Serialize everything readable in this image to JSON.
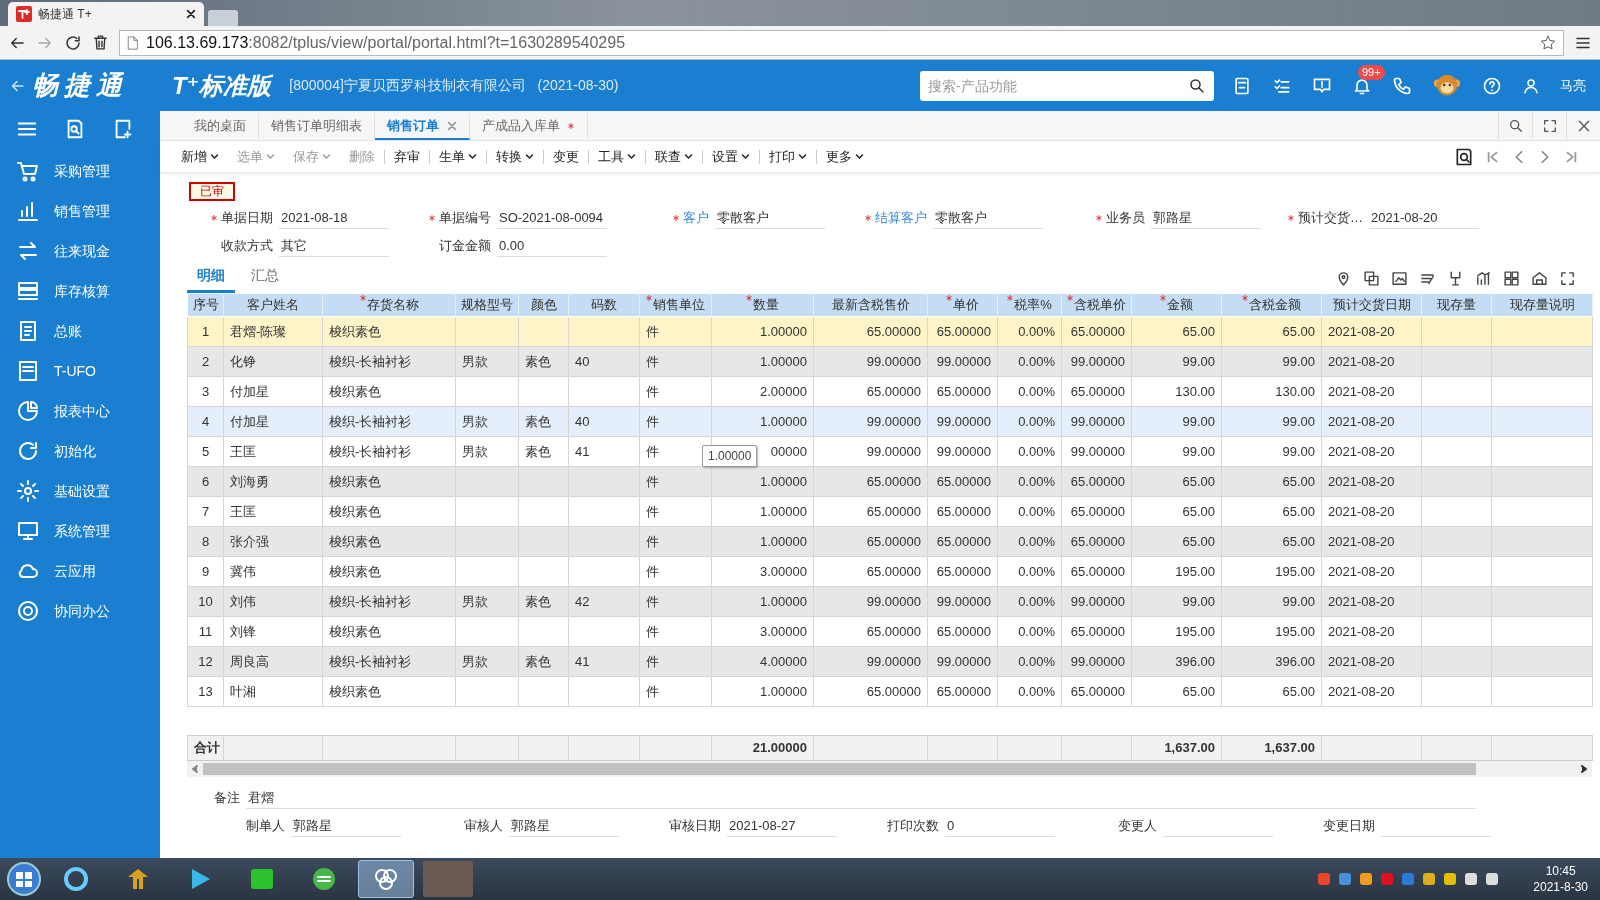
{
  "browser": {
    "tab_title": "畅捷通 T+",
    "url_host": "106.13.69.173",
    "url_path": ":8082/tplus/view/portal/portal.html?t=1630289540295"
  },
  "header": {
    "brand": "畅捷通",
    "edition": "T⁺标准版",
    "company": "[800004]宁夏贝西罗科技制衣有限公司   (2021-08-30)",
    "search_placeholder": "搜索-产品功能",
    "notification_badge": "99+",
    "user": "马亮"
  },
  "sidebar": {
    "items": [
      {
        "label": "采购管理"
      },
      {
        "label": "销售管理"
      },
      {
        "label": "往来现金"
      },
      {
        "label": "库存核算"
      },
      {
        "label": "总账"
      },
      {
        "label": "T-UFO"
      },
      {
        "label": "报表中心"
      },
      {
        "label": "初始化"
      },
      {
        "label": "基础设置"
      },
      {
        "label": "系统管理"
      },
      {
        "label": "云应用"
      },
      {
        "label": "协同办公"
      }
    ]
  },
  "doc_tabs": [
    {
      "label": "我的桌面",
      "selected": false,
      "closable": false,
      "modified": false
    },
    {
      "label": "销售订单明细表",
      "selected": false,
      "closable": false,
      "modified": false
    },
    {
      "label": "销售订单",
      "selected": true,
      "closable": true,
      "modified": false
    },
    {
      "label": "产成品入库单",
      "selected": false,
      "closable": false,
      "modified": true
    }
  ],
  "toolbar": [
    {
      "label": "新增",
      "dropdown": true,
      "disabled": false
    },
    {
      "label": "选单",
      "dropdown": true,
      "disabled": true
    },
    {
      "label": "保存",
      "dropdown": true,
      "disabled": true
    },
    {
      "label": "删除",
      "dropdown": false,
      "disabled": true
    },
    {
      "label": "弃审",
      "dropdown": false,
      "disabled": false
    },
    {
      "label": "生单",
      "dropdown": true,
      "disabled": false
    },
    {
      "label": "转换",
      "dropdown": true,
      "disabled": false
    },
    {
      "label": "变更",
      "dropdown": false,
      "disabled": false
    },
    {
      "label": "工具",
      "dropdown": true,
      "disabled": false
    },
    {
      "label": "联查",
      "dropdown": true,
      "disabled": false
    },
    {
      "label": "设置",
      "dropdown": true,
      "disabled": false
    },
    {
      "label": "打印",
      "dropdown": true,
      "disabled": false
    },
    {
      "label": "更多",
      "dropdown": true,
      "disabled": false
    }
  ],
  "status_stamp": "已审",
  "form_fields": [
    {
      "label": "单据日期",
      "value": "2021-08-18",
      "required": true,
      "link": false
    },
    {
      "label": "单据编号",
      "value": "SO-2021-08-0094",
      "required": true,
      "link": false
    },
    {
      "label": "客户",
      "value": "零散客户",
      "required": true,
      "link": true
    },
    {
      "label": "结算客户",
      "value": "零散客户",
      "required": true,
      "link": true
    },
    {
      "label": "业务员",
      "value": "郭路星",
      "required": true,
      "link": false
    },
    {
      "label": "预计交货…",
      "value": "2021-08-20",
      "required": true,
      "link": false
    },
    {
      "label": "收款方式",
      "value": "其它",
      "required": false,
      "link": false
    },
    {
      "label": "订金金额",
      "value": "0.00",
      "required": false,
      "link": false
    }
  ],
  "detail_tabs": [
    {
      "label": "明细",
      "selected": true
    },
    {
      "label": "汇总",
      "selected": false
    }
  ],
  "table": {
    "columns": [
      {
        "label": "序号",
        "required": false
      },
      {
        "label": "客户姓名",
        "required": false
      },
      {
        "label": "存货名称",
        "required": true
      },
      {
        "label": "规格型号",
        "required": false
      },
      {
        "label": "颜色",
        "required": false
      },
      {
        "label": "码数",
        "required": false
      },
      {
        "label": "销售单位",
        "required": true
      },
      {
        "label": "数量",
        "required": true
      },
      {
        "label": "最新含税售价",
        "required": false
      },
      {
        "label": "单价",
        "required": true
      },
      {
        "label": "税率%",
        "required": true
      },
      {
        "label": "含税单价",
        "required": true
      },
      {
        "label": "金额",
        "required": true
      },
      {
        "label": "含税金额",
        "required": true
      },
      {
        "label": "预计交货日期",
        "required": false
      },
      {
        "label": "现存量",
        "required": false
      },
      {
        "label": "现存量说明",
        "required": false
      }
    ],
    "rows": [
      {
        "selected": true,
        "highlighted": false,
        "no": "1",
        "customer": "君熠-陈璨",
        "item": "梭织素色",
        "unit": "件",
        "qty": "1.00000",
        "latest_price": "65.00000",
        "price": "65.00000",
        "tax_rate": "0.00%",
        "tax_price": "65.00000",
        "amount": "65.00",
        "tax_amount": "65.00",
        "delivery_date": "2021-08-20"
      },
      {
        "selected": false,
        "highlighted": false,
        "no": "2",
        "customer": "化铮",
        "item": "梭织-长袖衬衫",
        "spec": "男款",
        "shade": "素色",
        "size": "40",
        "unit": "件",
        "qty": "1.00000",
        "latest_price": "99.00000",
        "price": "99.00000",
        "tax_rate": "0.00%",
        "tax_price": "99.00000",
        "amount": "99.00",
        "tax_amount": "99.00",
        "delivery_date": "2021-08-20"
      },
      {
        "selected": false,
        "highlighted": false,
        "no": "3",
        "customer": "付加星",
        "item": "梭织素色",
        "unit": "件",
        "qty": "2.00000",
        "latest_price": "65.00000",
        "price": "65.00000",
        "tax_rate": "0.00%",
        "tax_price": "65.00000",
        "amount": "130.00",
        "tax_amount": "130.00",
        "delivery_date": "2021-08-20"
      },
      {
        "selected": false,
        "highlighted": true,
        "no": "4",
        "customer": "付加星",
        "item": "梭织-长袖衬衫",
        "spec": "男款",
        "shade": "素色",
        "size": "40",
        "unit": "件",
        "qty": "1.00000",
        "latest_price": "99.00000",
        "price": "99.00000",
        "tax_rate": "0.00%",
        "tax_price": "99.00000",
        "amount": "99.00",
        "tax_amount": "99.00",
        "delivery_date": "2021-08-20"
      },
      {
        "selected": false,
        "highlighted": false,
        "no": "5",
        "customer": "王匡",
        "item": "梭织-长袖衬衫",
        "spec": "男款",
        "shade": "素色",
        "size": "41",
        "unit": "件",
        "tooltip": "1.00000",
        "qty": "00000",
        "latest_price": "99.00000",
        "price": "99.00000",
        "tax_rate": "0.00%",
        "tax_price": "99.00000",
        "amount": "99.00",
        "tax_amount": "99.00",
        "delivery_date": "2021-08-20"
      },
      {
        "selected": false,
        "highlighted": false,
        "no": "6",
        "customer": "刘海勇",
        "item": "梭织素色",
        "unit": "件",
        "qty": "1.00000",
        "latest_price": "65.00000",
        "price": "65.00000",
        "tax_rate": "0.00%",
        "tax_price": "65.00000",
        "amount": "65.00",
        "tax_amount": "65.00",
        "delivery_date": "2021-08-20"
      },
      {
        "selected": false,
        "highlighted": false,
        "no": "7",
        "customer": "王匡",
        "item": "梭织素色",
        "unit": "件",
        "qty": "1.00000",
        "latest_price": "65.00000",
        "price": "65.00000",
        "tax_rate": "0.00%",
        "tax_price": "65.00000",
        "amount": "65.00",
        "tax_amount": "65.00",
        "delivery_date": "2021-08-20"
      },
      {
        "selected": false,
        "highlighted": false,
        "no": "8",
        "customer": "张介强",
        "item": "梭织素色",
        "unit": "件",
        "qty": "1.00000",
        "latest_price": "65.00000",
        "price": "65.00000",
        "tax_rate": "0.00%",
        "tax_price": "65.00000",
        "amount": "65.00",
        "tax_amount": "65.00",
        "delivery_date": "2021-08-20"
      },
      {
        "selected": false,
        "highlighted": false,
        "no": "9",
        "customer": "冀伟",
        "item": "梭织素色",
        "unit": "件",
        "qty": "3.00000",
        "latest_price": "65.00000",
        "price": "65.00000",
        "tax_rate": "0.00%",
        "tax_price": "65.00000",
        "amount": "195.00",
        "tax_amount": "195.00",
        "delivery_date": "2021-08-20"
      },
      {
        "selected": false,
        "highlighted": false,
        "no": "10",
        "customer": "刘伟",
        "item": "梭织-长袖衬衫",
        "spec": "男款",
        "shade": "素色",
        "size": "42",
        "unit": "件",
        "qty": "1.00000",
        "latest_price": "99.00000",
        "price": "99.00000",
        "tax_rate": "0.00%",
        "tax_price": "99.00000",
        "amount": "99.00",
        "tax_amount": "99.00",
        "delivery_date": "2021-08-20"
      },
      {
        "selected": false,
        "highlighted": false,
        "no": "11",
        "customer": "刘锋",
        "item": "梭织素色",
        "unit": "件",
        "qty": "3.00000",
        "latest_price": "65.00000",
        "price": "65.00000",
        "tax_rate": "0.00%",
        "tax_price": "65.00000",
        "amount": "195.00",
        "tax_amount": "195.00",
        "delivery_date": "2021-08-20"
      },
      {
        "selected": false,
        "highlighted": false,
        "no": "12",
        "customer": "周良高",
        "item": "梭织-长袖衬衫",
        "spec": "男款",
        "shade": "素色",
        "size": "41",
        "unit": "件",
        "qty": "4.00000",
        "latest_price": "99.00000",
        "price": "99.00000",
        "tax_rate": "0.00%",
        "tax_price": "99.00000",
        "amount": "396.00",
        "tax_amount": "396.00",
        "delivery_date": "2021-08-20"
      },
      {
        "selected": false,
        "highlighted": false,
        "no": "13",
        "customer": "叶湘",
        "item": "梭织素色",
        "unit": "件",
        "qty": "1.00000",
        "latest_price": "65.00000",
        "price": "65.00000",
        "tax_rate": "0.00%",
        "tax_price": "65.00000",
        "amount": "65.00",
        "tax_amount": "65.00",
        "delivery_date": "2021-08-20"
      }
    ],
    "totals": {
      "no": "合计",
      "qty": "21.00000",
      "amount": "1,637.00",
      "tax_amount": "1,637.00"
    }
  },
  "remark": {
    "label": "备注",
    "value": "君熠"
  },
  "footer_fields": [
    {
      "label": "制单人",
      "value": "郭路星"
    },
    {
      "label": "审核人",
      "value": "郭路星"
    },
    {
      "label": "审核日期",
      "value": "2021-08-27"
    },
    {
      "label": "打印次数",
      "value": "0"
    },
    {
      "label": "变更人"
    },
    {
      "label": "变更日期"
    }
  ],
  "taskbar": {
    "apps": [
      {
        "selected": false
      },
      {
        "selected": false
      },
      {
        "selected": false
      },
      {
        "selected": false
      },
      {
        "selected": false
      },
      {
        "selected": true
      },
      {
        "selected": false
      }
    ],
    "time": "10:45",
    "date": "2021-8-30"
  }
}
